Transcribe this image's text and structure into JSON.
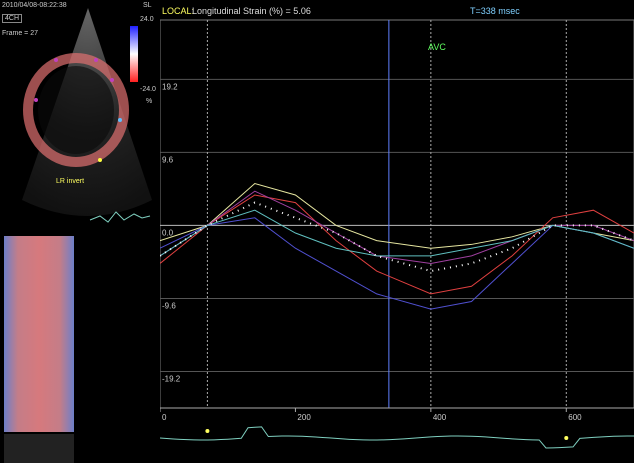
{
  "echo": {
    "timestamp": "2010/04/08-08:22:38",
    "view": "4CH",
    "frame": "Frame = 27",
    "scale_label": "SL",
    "scale_top": "24.0",
    "scale_bottom": "-24.0",
    "unit": "%",
    "segment_label": "LR invert"
  },
  "header": {
    "local_label": "LOCAL:",
    "metric": "Longitudinal Strain (%) = 5.06",
    "time": "T=338 msec",
    "event": "AVC"
  },
  "chart_data": {
    "type": "line",
    "title": "",
    "xlabel": "",
    "ylabel": "",
    "xlim": [
      0,
      700
    ],
    "ylim": [
      -24,
      27
    ],
    "y_ticks": [
      19.2,
      9.6,
      0.0,
      -9.6,
      -19.2
    ],
    "x_ticks": [
      0,
      200,
      400,
      600
    ],
    "markers_ms": [
      70,
      338,
      400,
      600
    ],
    "series": [
      {
        "color": "#e6e6a0",
        "x": [
          0,
          70,
          140,
          200,
          260,
          320,
          400,
          460,
          520,
          580,
          640,
          700
        ],
        "values": [
          -2,
          0,
          5.5,
          4,
          0,
          -2,
          -3,
          -2.5,
          -1.5,
          0,
          -1,
          -2
        ]
      },
      {
        "color": "#e04040",
        "x": [
          0,
          70,
          140,
          200,
          260,
          320,
          400,
          460,
          520,
          580,
          640,
          700
        ],
        "values": [
          -5,
          0,
          4,
          3,
          -2,
          -6,
          -9,
          -8,
          -4,
          1,
          2,
          -1
        ]
      },
      {
        "color": "#a040a0",
        "x": [
          0,
          70,
          140,
          200,
          260,
          320,
          400,
          460,
          520,
          580,
          640,
          700
        ],
        "values": [
          -4,
          0,
          4.5,
          2,
          -1,
          -4,
          -5,
          -4,
          -2,
          0,
          0,
          -2
        ]
      },
      {
        "color": "#5050d0",
        "x": [
          0,
          70,
          140,
          200,
          260,
          320,
          400,
          460,
          520,
          580,
          640,
          700
        ],
        "values": [
          -3,
          0,
          1,
          -3,
          -6,
          -9,
          -11,
          -10,
          -5,
          0,
          -1,
          -3
        ]
      },
      {
        "color": "#60c0c0",
        "x": [
          0,
          70,
          140,
          200,
          260,
          320,
          400,
          460,
          520,
          580,
          640,
          700
        ],
        "values": [
          -4,
          0,
          2,
          -1,
          -3,
          -4,
          -4,
          -3,
          -2,
          0,
          -1,
          -3
        ]
      },
      {
        "color": "#ffffff",
        "dotted": true,
        "x": [
          0,
          70,
          140,
          200,
          260,
          320,
          400,
          460,
          520,
          580,
          640,
          700
        ],
        "values": [
          -4,
          0,
          3,
          1,
          -1,
          -4,
          -6,
          -5,
          -3,
          0,
          0,
          -2
        ]
      }
    ]
  },
  "ecg": {
    "color": "#7fd0c0",
    "marker_color": "#ffff60"
  }
}
